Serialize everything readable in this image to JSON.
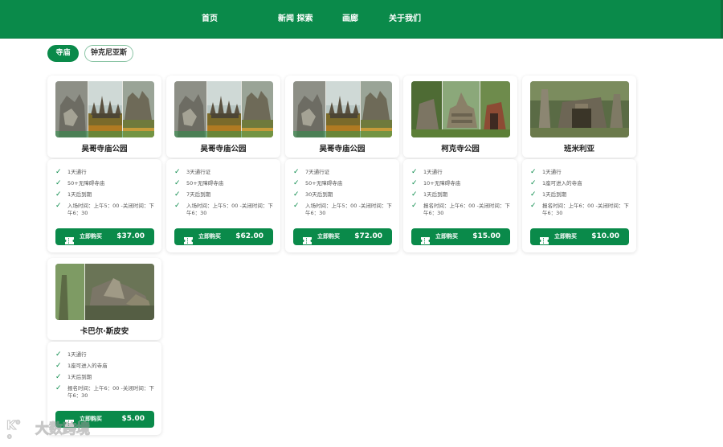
{
  "nav": {
    "home": "首页",
    "news": "新闻 探索",
    "gallery": "画廊",
    "about": "关于我们"
  },
  "filters": {
    "active": "寺庙",
    "other": "钟克尼亚斯"
  },
  "cards": [
    {
      "title": "吴哥寺庙公园",
      "features": [
        "1天通行",
        "50+无障碍寺庙",
        "1天后到期",
        "入场时间：上午5：00 -关闭时间：下午6：30"
      ],
      "buy_label": "立即购买",
      "price": "$37.00",
      "image": "angkor-wat-photo"
    },
    {
      "title": "吴哥寺庙公园",
      "features": [
        "3天通行证",
        "50+无障碍寺庙",
        "7天后到期",
        "入场时间：上午5：00 -关闭时间：下午6：30"
      ],
      "buy_label": "立即购买",
      "price": "$62.00",
      "image": "angkor-wat-photo"
    },
    {
      "title": "吴哥寺庙公园",
      "features": [
        "7天通行证",
        "50+无障碍寺庙",
        "30天后到期",
        "入场时间：上午5：00 -关闭时间：下午6：30"
      ],
      "buy_label": "立即购买",
      "price": "$72.00",
      "image": "angkor-wat-photo"
    },
    {
      "title": "柯克寺公园",
      "features": [
        "1天通行",
        "10+无障碍寺庙",
        "1天后到期",
        "报名时间：上午6：00 -关闭时间：下午6：30"
      ],
      "buy_label": "立即购买",
      "price": "$15.00",
      "image": "koh-ker-photo"
    },
    {
      "title": "班米利亚",
      "features": [
        "1天通行",
        "1座可进入的寺庙",
        "1天后到期",
        "报名时间：上午6：00 -关闭时间：下午6：30"
      ],
      "buy_label": "立即购买",
      "price": "$10.00",
      "image": "beng-mealea-photo"
    },
    {
      "title": "卡巴尔·斯皮安",
      "features": [
        "1天通行",
        "1座可进入的寺庙",
        "1天后到期",
        "报名时间：上午6：00 -关闭时间：下午6：30"
      ],
      "buy_label": "立即购买",
      "price": "$5.00",
      "image": "kbal-spean-photo"
    }
  ],
  "watermark": {
    "logo": "K°°",
    "brand": "大数跨境"
  },
  "colors": {
    "brand_green": "#0a8a4a",
    "check_green": "#0a8a4a"
  }
}
